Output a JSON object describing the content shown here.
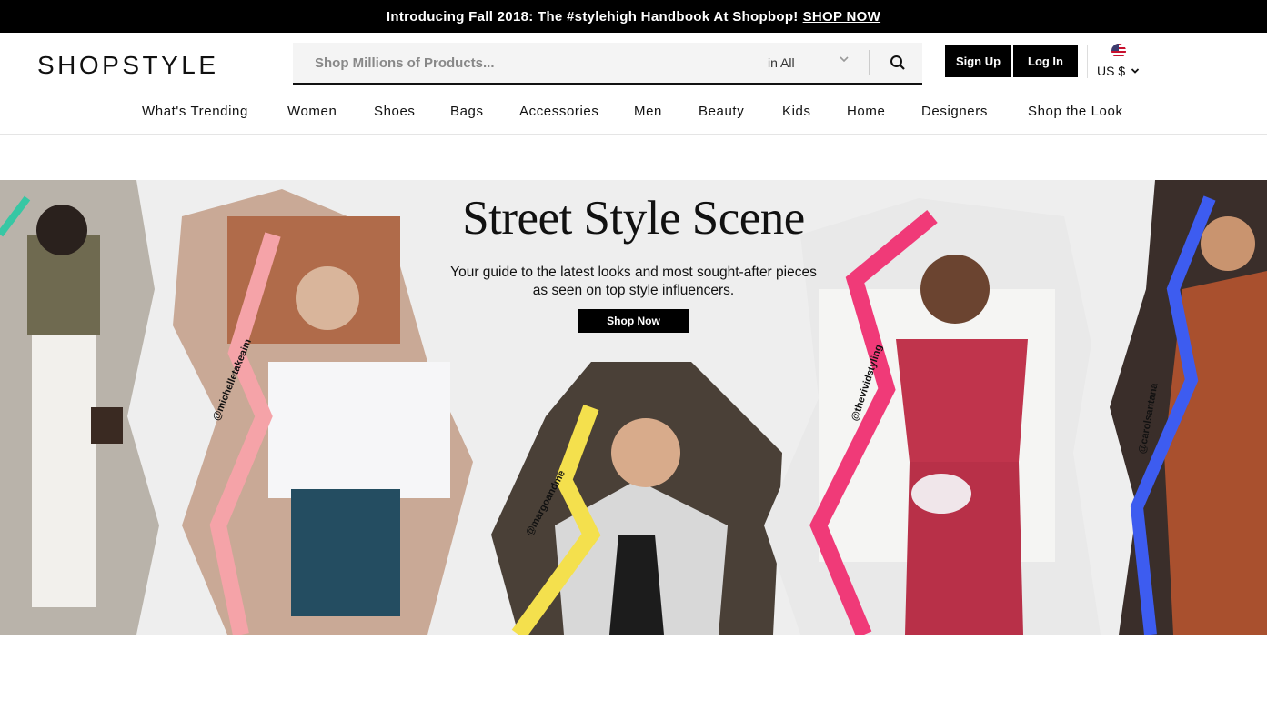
{
  "promo": {
    "text": "Introducing Fall 2018: The #stylehigh Handbook At Shopbop!",
    "link": "SHOP NOW"
  },
  "header": {
    "logo": "SHOPSTYLE",
    "search": {
      "placeholder": "Shop Millions of Products...",
      "value": "",
      "scope": "in All"
    },
    "signup": "Sign Up",
    "login": "Log In",
    "currency": "US $"
  },
  "nav": {
    "items": [
      "What's Trending",
      "Women",
      "Shoes",
      "Bags",
      "Accessories",
      "Men",
      "Beauty",
      "Kids",
      "Home",
      "Designers",
      "Shop the Look"
    ]
  },
  "hero": {
    "title": "Street Style Scene",
    "subtitle": "Your guide to the latest looks and most sought-after pieces as seen on top style influencers.",
    "button": "Shop Now",
    "handles": [
      "@michelletakeaim",
      "@margoandme",
      "@thevividstyling",
      "@carolsantana"
    ]
  },
  "colors": {
    "accent_pink": "#f03a78",
    "accent_yellow": "#f4e04d",
    "accent_blue": "#3d5cf0",
    "accent_salmon": "#f5a3a8"
  }
}
